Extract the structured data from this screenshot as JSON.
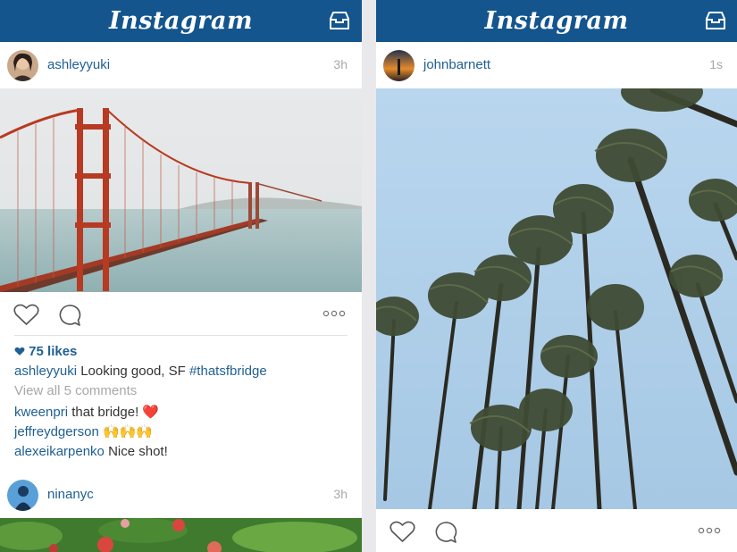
{
  "app": {
    "title": "Instagram"
  },
  "left_feed": {
    "post1": {
      "username": "ashleyyuki",
      "time": "3h",
      "likes": "75 likes",
      "caption_user": "ashleyyuki",
      "caption_text": " Looking good, SF ",
      "caption_tag": "#thatsfbridge",
      "view_comments": "View all 5 comments",
      "comments": [
        {
          "user": "kweenpri",
          "text": " that bridge! ❤️"
        },
        {
          "user": "jeffreydgerson",
          "text": " 🙌🙌🙌"
        },
        {
          "user": "alexeikarpenko",
          "text": " Nice shot!"
        }
      ]
    },
    "post2": {
      "username": "ninanyc",
      "time": "3h"
    }
  },
  "right_feed": {
    "post1": {
      "username": "johnbarnett",
      "time": "1s"
    }
  },
  "colors": {
    "header": "#14558d",
    "link": "#1f5f93",
    "muted": "#a8a8a8"
  },
  "icons": [
    "inbox-icon",
    "heart-icon",
    "comment-icon",
    "more-icon"
  ]
}
